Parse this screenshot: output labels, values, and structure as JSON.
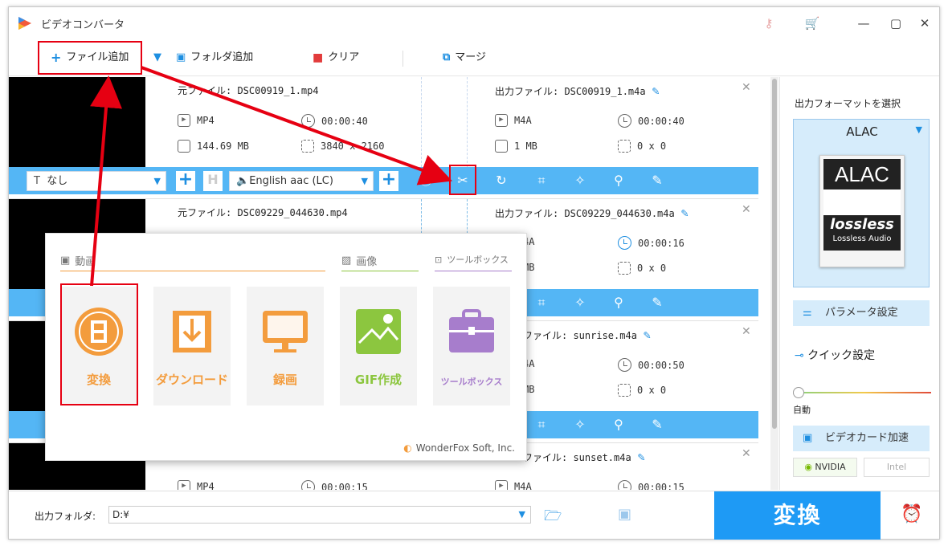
{
  "window": {
    "title": "ビデオコンバータ"
  },
  "toolbar": {
    "add_file": "ファイル追加",
    "add_folder": "フォルダ追加",
    "clear": "クリア",
    "merge": "マージ"
  },
  "items": [
    {
      "src_label": "元ファイル: DSC00919_1.mp4",
      "dst_label": "出力ファイル: DSC00919_1.m4a",
      "src_format": "MP4",
      "src_duration": "00:00:40",
      "src_size": "144.69 MB",
      "src_res": "3840 x 2160",
      "dst_format": "M4A",
      "dst_duration": "00:00:40",
      "dst_size": "1 MB",
      "dst_res": "0 x 0",
      "subtitle": "なし",
      "audio": "English aac (LC)"
    },
    {
      "src_label": "元ファイル: DSC09229_044630.mp4",
      "dst_label": "出力ファイル: DSC09229_044630.m4a",
      "dst_format": "4A",
      "dst_duration": "00:00:16",
      "dst_size": "MB",
      "dst_res": "0 x 0"
    },
    {
      "dst_label": "ファイル: sunrise.m4a",
      "dst_format": "4A",
      "dst_duration": "00:00:50",
      "dst_size": "MB",
      "dst_res": "0 x 0"
    },
    {
      "dst_label": "ファイル: sunset.m4a",
      "src_format": "MP4",
      "src_duration": "00:00:15",
      "dst_format": "M4A",
      "dst_duration": "00:00:15"
    }
  ],
  "panel": {
    "title": "出力フォーマットを選択",
    "format": "ALAC",
    "card_top": "ALAC",
    "card_logo": "lossless",
    "card_sub": "Lossless Audio",
    "param": "パラメータ設定",
    "quick": "クイック設定",
    "auto": "自動",
    "gpu": "ビデオカード加速",
    "nvidia": "NVIDIA",
    "intel": "Intel"
  },
  "bottom": {
    "folder_label": "出力フォルダ:",
    "folder_value": "D:¥",
    "convert": "変換"
  },
  "popup": {
    "sec_video": "動画",
    "sec_image": "画像",
    "sec_tools": "ツールボックス",
    "tiles": [
      "変換",
      "ダウンロード",
      "録画",
      "GIF作成",
      "ツールボックス"
    ],
    "brand": "WonderFox Soft, Inc."
  },
  "colors": {
    "accent": "#1e9af5",
    "bar": "#54b6f5",
    "highlight": "#e60012",
    "orange": "#f39c3d",
    "green": "#8cc63f",
    "purple": "#a77dcc"
  }
}
